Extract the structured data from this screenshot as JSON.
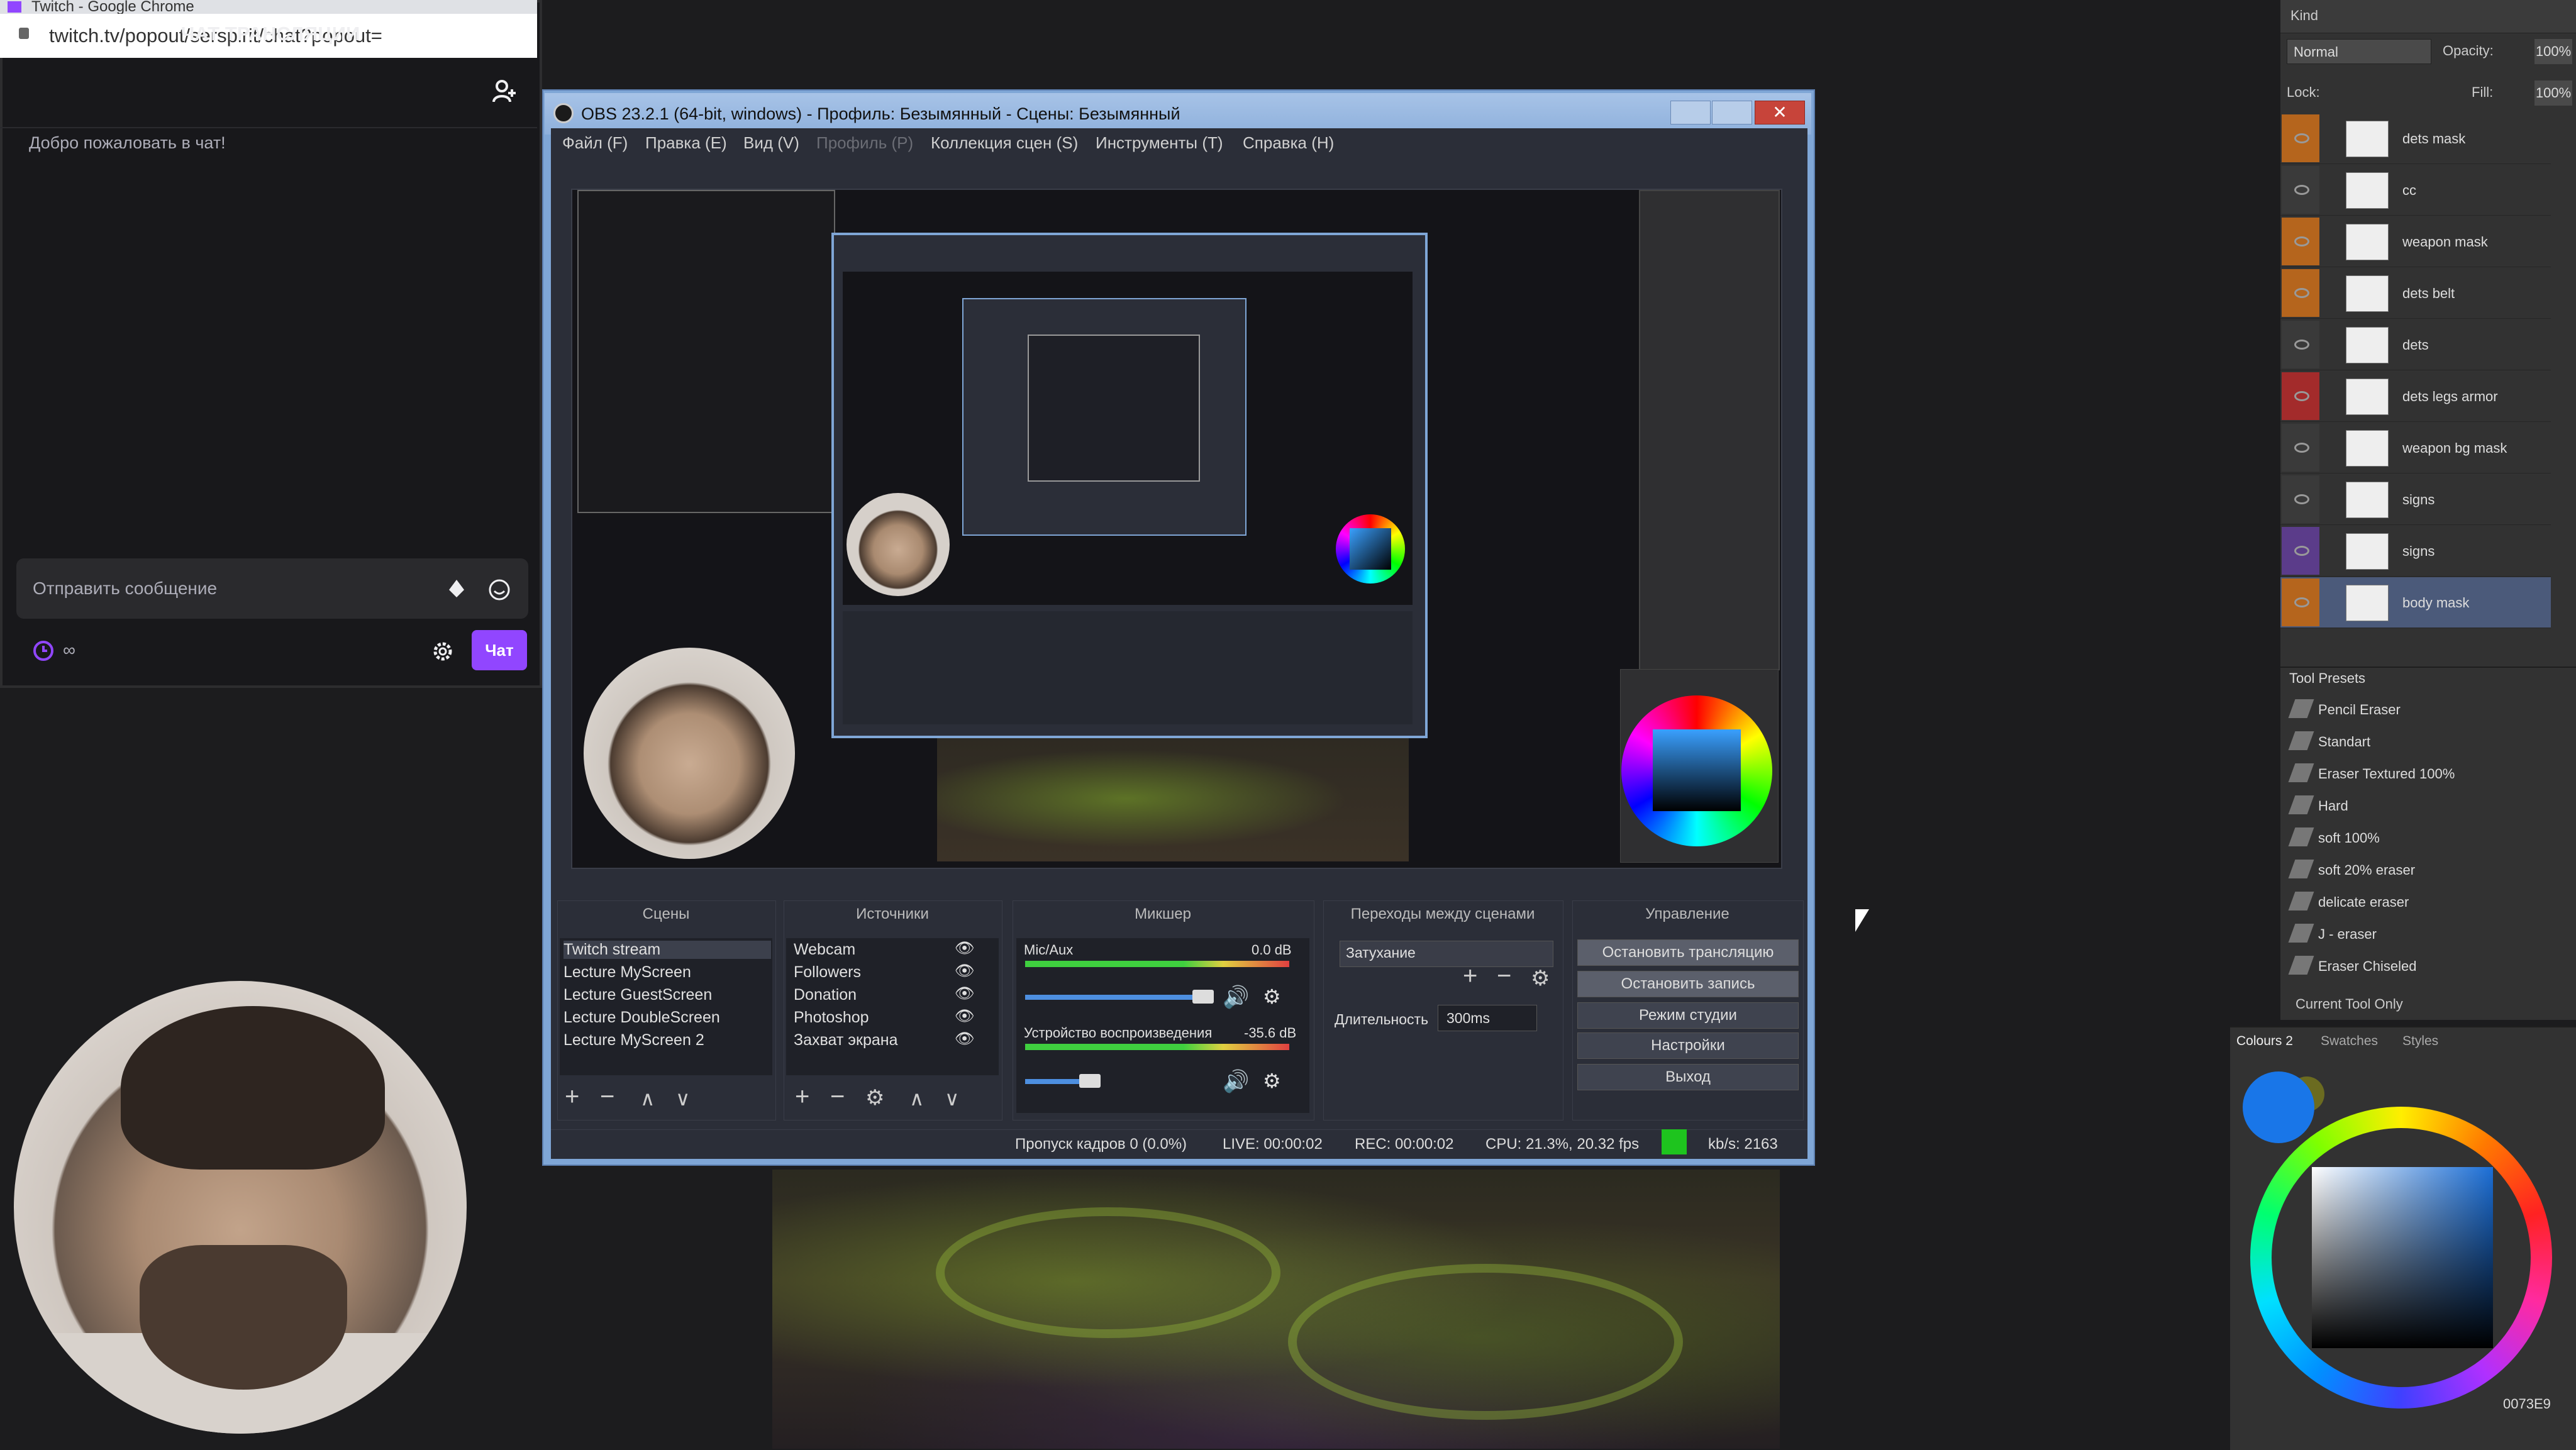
{
  "chrome": {
    "window_title": "Twitch - Google Chrome",
    "url": "twitch.tv/popout/serspirit/chat?popout="
  },
  "chat": {
    "header": "ЧАТ ТРАНСЛЯЦИИ",
    "welcome": "Добро пожаловать в чат!",
    "input_placeholder": "Отправить сообщение",
    "points": "∞",
    "send_button": "Чат",
    "accent_color": "#9146ff"
  },
  "obs": {
    "title": "OBS 23.2.1 (64-bit, windows) - Профиль: Безымянный - Сцены: Безымянный",
    "menu": [
      "Файл (F)",
      "Правка (E)",
      "Вид (V)",
      "Профиль (P)",
      "Коллекция сцен (S)",
      "Инструменты (T)",
      "Справка (H)"
    ],
    "docks": {
      "scenes": {
        "title": "Сцены",
        "items": [
          "Twitch stream",
          "Lecture MyScreen",
          "Lecture GuestScreen",
          "Lecture DoubleScreen",
          "Lecture MyScreen 2"
        ]
      },
      "sources": {
        "title": "Источники",
        "items": [
          "Webcam",
          "Followers",
          "Donation",
          "Photoshop",
          "Захват экрана"
        ]
      },
      "mixer": {
        "title": "Микшер",
        "channels": [
          {
            "name": "Mic/Aux",
            "db": "0.0 dB"
          },
          {
            "name": "Устройство воспроизведения",
            "db": "-35.6 dB"
          }
        ]
      },
      "transitions": {
        "title": "Переходы между сценами",
        "selected": "Затухание",
        "duration_label": "Длительность",
        "duration": "300ms"
      },
      "controls": {
        "title": "Управление",
        "buttons": [
          "Остановить трансляцию",
          "Остановить запись",
          "Режим студии",
          "Настройки",
          "Выход"
        ]
      }
    },
    "status": {
      "dropped": "Пропуск кадров 0 (0.0%)",
      "live": "LIVE: 00:00:02",
      "rec": "REC: 00:00:02",
      "cpu": "CPU: 21.3%, 20.32 fps",
      "kbps": "kb/s: 2163",
      "indicator_color": "#1ec41e"
    }
  },
  "photoshop": {
    "kind": "Kind",
    "blend_mode": "Normal",
    "opacity_label": "Opacity:",
    "opacity": "100%",
    "lock_label": "Lock:",
    "fill_label": "Fill:",
    "fill": "100%",
    "layers": [
      {
        "name": "dets mask",
        "swatch": "#b5651d"
      },
      {
        "name": "cc",
        "swatch": "#3a3a3a"
      },
      {
        "name": "weapon mask",
        "swatch": "#b5651d"
      },
      {
        "name": "dets belt",
        "swatch": "#b5651d"
      },
      {
        "name": "dets",
        "swatch": "#3a3a3a"
      },
      {
        "name": "dets legs armor",
        "swatch": "#a32b2b"
      },
      {
        "name": "weapon bg mask",
        "swatch": "#3a3a3a"
      },
      {
        "name": "signs",
        "swatch": "#3a3a3a"
      },
      {
        "name": "signs",
        "swatch": "#5b3c8a"
      },
      {
        "name": "body mask",
        "swatch": "#b5651d"
      }
    ],
    "tool_presets": {
      "title": "Tool Presets",
      "items": [
        "Pencil Eraser",
        "Standart",
        "Eraser Textured 100%",
        "Hard",
        "soft 100%",
        "soft 20% eraser",
        "delicate eraser",
        "J - eraser",
        "Eraser Chiseled"
      ],
      "current_only": "Current Tool Only"
    },
    "colour_tabs": [
      "Colours 2",
      "Swatches",
      "Styles"
    ],
    "hex": "0073E9",
    "foreground_color": "#1976e8"
  }
}
